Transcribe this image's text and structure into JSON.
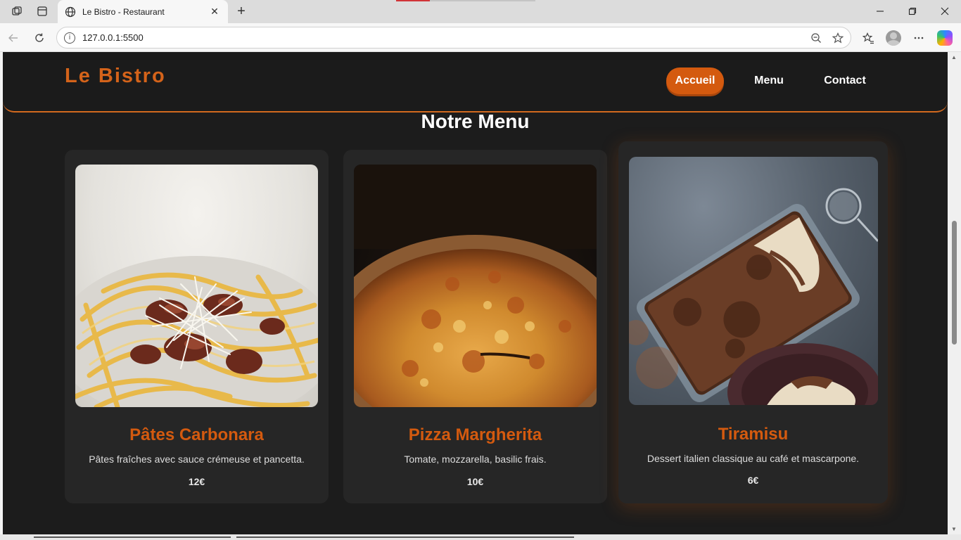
{
  "browser": {
    "tab_title": "Le Bistro - Restaurant",
    "url": "127.0.0.1:5500"
  },
  "site": {
    "logo": "Le Bistro",
    "nav": [
      {
        "label": "Accueil",
        "active": true
      },
      {
        "label": "Menu",
        "active": false
      },
      {
        "label": "Contact",
        "active": false
      }
    ],
    "section_title": "Notre Menu",
    "accent_color": "#d45a0f",
    "background_color": "#1c1c1c",
    "dishes": [
      {
        "name": "Pâtes Carbonara",
        "description": "Pâtes fraîches avec sauce crémeuse et pancetta.",
        "price": "12€",
        "image": "carbonara-photo"
      },
      {
        "name": "Pizza Margherita",
        "description": "Tomate, mozzarella, basilic frais.",
        "price": "10€",
        "image": "pizza-photo"
      },
      {
        "name": "Tiramisu",
        "description": "Dessert italien classique au café et mascarpone.",
        "price": "6€",
        "image": "tiramisu-photo"
      }
    ]
  }
}
